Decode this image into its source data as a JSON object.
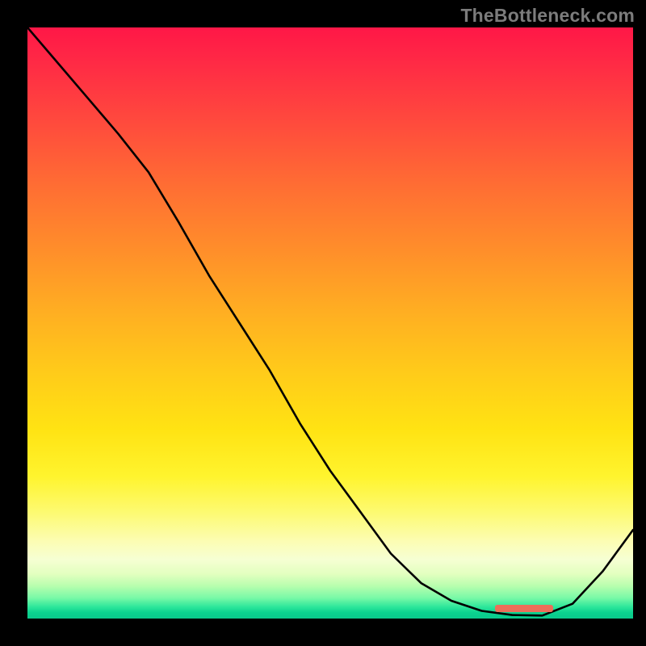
{
  "watermark": "TheBottleneck.com",
  "chart_data": {
    "type": "line",
    "title": "",
    "xlabel": "",
    "ylabel": "",
    "xlim": [
      0,
      100
    ],
    "ylim": [
      0,
      100
    ],
    "grid": false,
    "legend": false,
    "background": "vertical gradient red→yellow→green",
    "marker": {
      "x": 82,
      "width": 9.6,
      "color": "#ec6e59"
    },
    "series": [
      {
        "name": "curve",
        "color": "#000000",
        "x": [
          0,
          5,
          10,
          15,
          20,
          25,
          30,
          35,
          40,
          45,
          50,
          55,
          60,
          65,
          70,
          75,
          80,
          85,
          90,
          95,
          100
        ],
        "y": [
          100,
          94,
          88,
          82,
          75.5,
          67,
          58,
          50,
          42,
          33,
          25,
          18,
          11,
          6,
          3,
          1.3,
          0.6,
          0.5,
          2.5,
          8,
          15
        ]
      }
    ]
  }
}
